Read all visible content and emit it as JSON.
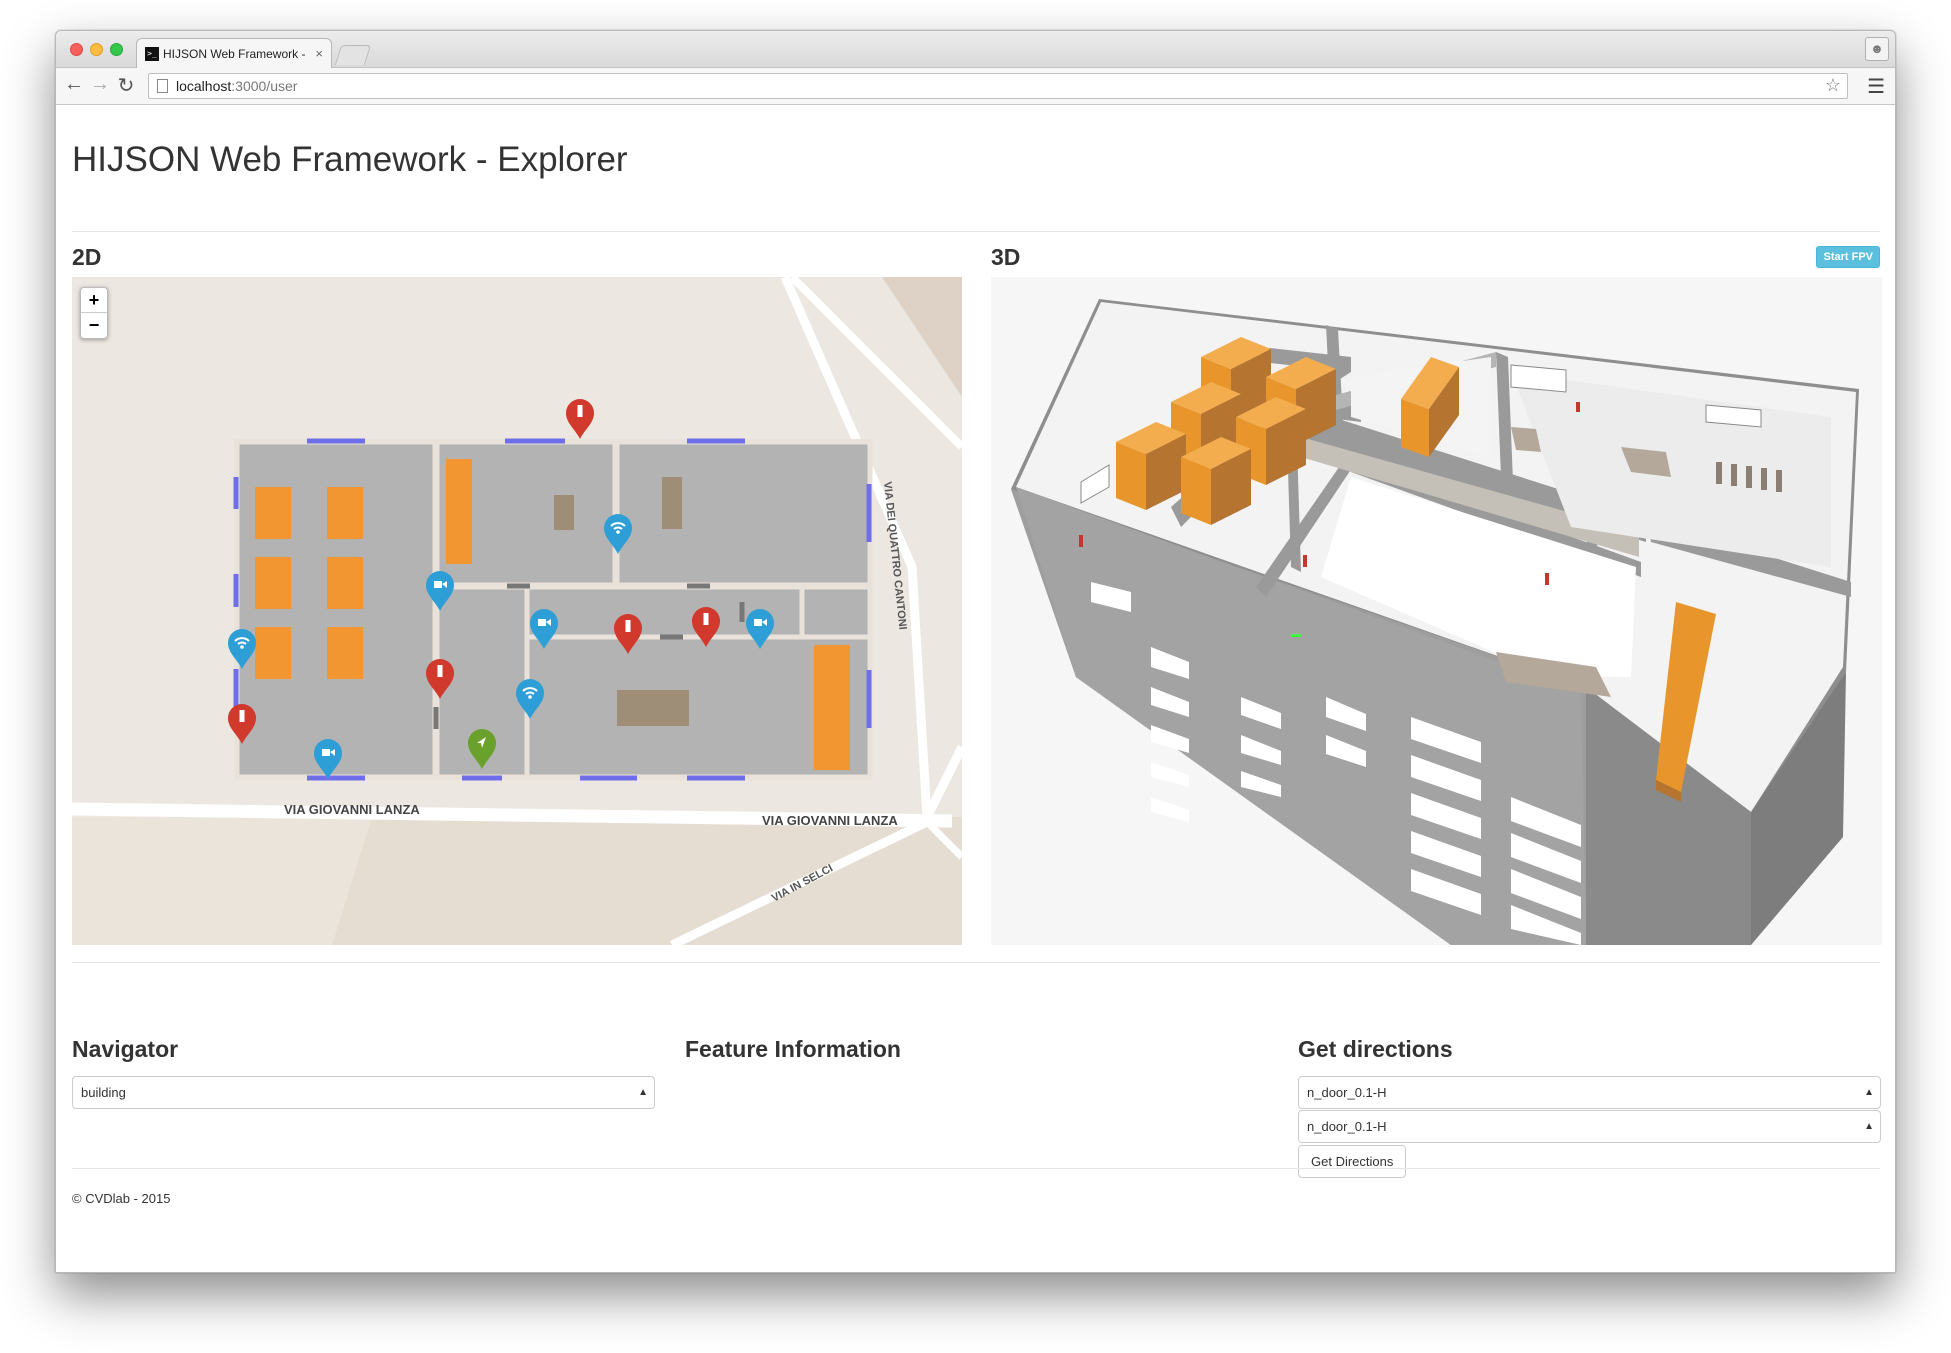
{
  "browser": {
    "tab_title": "HIJSON Web Framework -",
    "tab_close": "×",
    "url_host": "localhost",
    "url_rest": ":3000/user",
    "favicon_text": ">_"
  },
  "page": {
    "title": "HIJSON Web Framework - Explorer",
    "section_2d": "2D",
    "section_3d": "3D",
    "start_fpv_label": "Start FPV"
  },
  "map": {
    "zoom_in": "+",
    "zoom_out": "−",
    "streets": [
      "VIA GIOVANNI LANZA",
      "VIA GIOVANNI LANZA",
      "VIA DEI QUATTRO CANTONI",
      "VIA IN SELCI"
    ],
    "marker_colors": {
      "fire_extinguisher": "#d0392b",
      "wifi": "#2e9fd6",
      "camera": "#2e9fd6",
      "user": "#6aa12c"
    },
    "room_color": "#b3b3b3",
    "furniture_color": "#f29632",
    "door_color": "#6e6ee8"
  },
  "navigator": {
    "title": "Navigator",
    "selected": "building"
  },
  "feature_info": {
    "title": "Feature Information"
  },
  "directions": {
    "title": "Get directions",
    "from_selected": "n_door_0.1-H",
    "to_selected": "n_door_0.1-H",
    "button_label": "Get Directions"
  },
  "footer": {
    "text": "© CVDlab - 2015"
  }
}
